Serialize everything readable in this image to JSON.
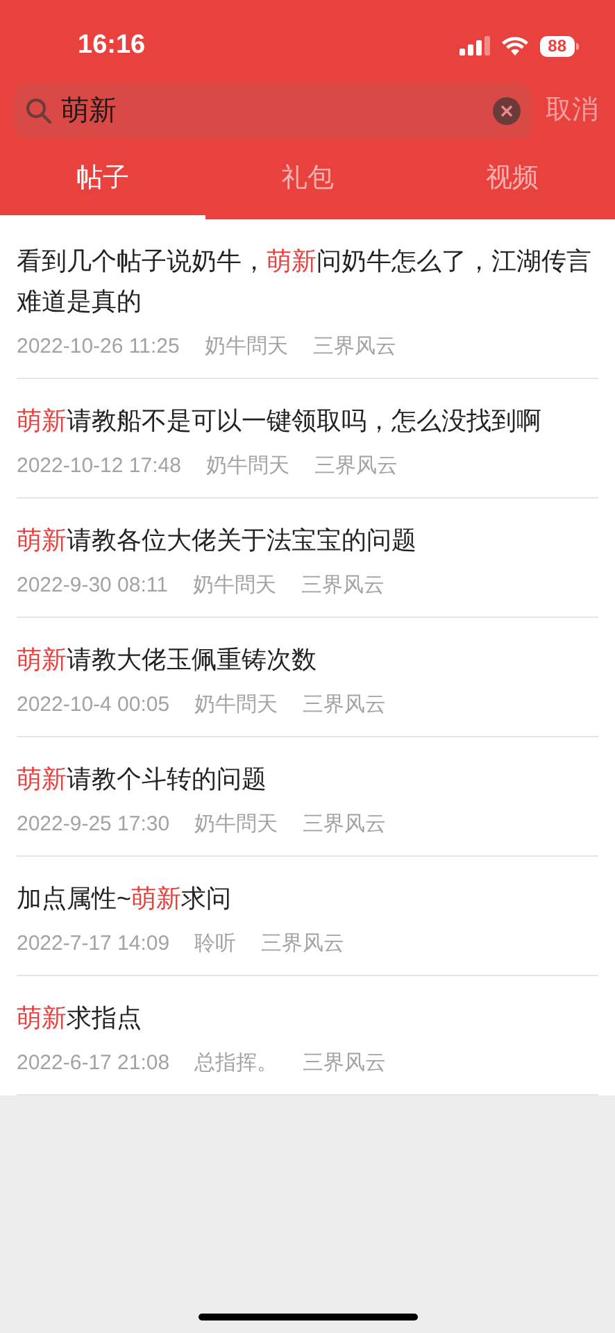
{
  "status_bar": {
    "time": "16:16",
    "battery": "88"
  },
  "search": {
    "value": "萌新",
    "cancel": "取消"
  },
  "tabs": [
    {
      "label": "帖子",
      "selected": true
    },
    {
      "label": "礼包",
      "selected": false
    },
    {
      "label": "视频",
      "selected": false
    }
  ],
  "posts": [
    {
      "title_parts": [
        {
          "text": "看到几个帖子说奶牛，",
          "highlight": false
        },
        {
          "text": "萌新",
          "highlight": true
        },
        {
          "text": "问奶牛怎么了，江湖传言难道是真的",
          "highlight": false
        }
      ],
      "time": "2022-10-26 11:25",
      "author": "奶牛問天",
      "server": "三界风云"
    },
    {
      "title_parts": [
        {
          "text": "萌新",
          "highlight": true
        },
        {
          "text": "请教船不是可以一键领取吗，怎么没找到啊",
          "highlight": false
        }
      ],
      "time": "2022-10-12 17:48",
      "author": "奶牛問天",
      "server": "三界风云"
    },
    {
      "title_parts": [
        {
          "text": "萌新",
          "highlight": true
        },
        {
          "text": "请教各位大佬关于法宝宝的问题",
          "highlight": false
        }
      ],
      "time": "2022-9-30 08:11",
      "author": "奶牛問天",
      "server": "三界风云"
    },
    {
      "title_parts": [
        {
          "text": "萌新",
          "highlight": true
        },
        {
          "text": "请教大佬玉佩重铸次数",
          "highlight": false
        }
      ],
      "time": "2022-10-4 00:05",
      "author": "奶牛問天",
      "server": "三界风云"
    },
    {
      "title_parts": [
        {
          "text": "萌新",
          "highlight": true
        },
        {
          "text": "请教个斗转的问题",
          "highlight": false
        }
      ],
      "time": "2022-9-25 17:30",
      "author": "奶牛問天",
      "server": "三界风云"
    },
    {
      "title_parts": [
        {
          "text": "加点属性~",
          "highlight": false
        },
        {
          "text": "萌新",
          "highlight": true
        },
        {
          "text": "求问",
          "highlight": false
        }
      ],
      "time": "2022-7-17 14:09",
      "author": "聆听",
      "server": "三界风云"
    },
    {
      "title_parts": [
        {
          "text": "萌新",
          "highlight": true
        },
        {
          "text": "求指点",
          "highlight": false
        }
      ],
      "time": "2022-6-17 21:08",
      "author": "总指挥。",
      "server": "三界风云"
    }
  ]
}
